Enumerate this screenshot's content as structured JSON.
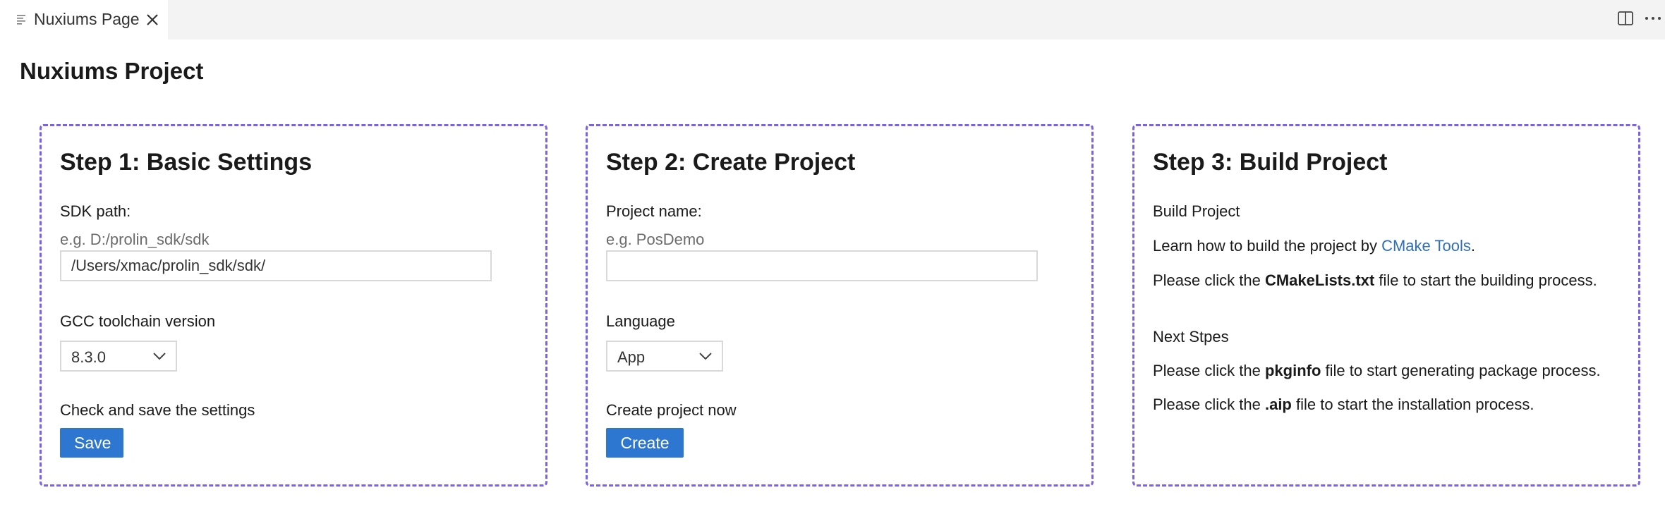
{
  "tab": {
    "title": "Nuxiums Page",
    "icon": "preview-lines-icon",
    "close_icon": "close-icon"
  },
  "toolbar": {
    "split_icon": "split-editor-icon",
    "more_icon": "more-actions-icon"
  },
  "page": {
    "title": "Nuxiums Project"
  },
  "step1": {
    "heading": "Step 1: Basic Settings",
    "sdk_label": "SDK path:",
    "sdk_hint": "e.g. D:/prolin_sdk/sdk",
    "sdk_value": "/Users/xmac/prolin_sdk/sdk/",
    "gcc_label": "GCC toolchain version",
    "gcc_value": "8.3.0",
    "save_label": "Check and save the settings",
    "save_button": "Save"
  },
  "step2": {
    "heading": "Step 2: Create Project",
    "name_label": "Project name:",
    "name_hint": "e.g. PosDemo",
    "name_value": "",
    "language_label": "Language",
    "language_value": "App",
    "create_label": "Create project now",
    "create_button": "Create"
  },
  "step3": {
    "heading": "Step 3: Build Project",
    "build_title": "Build Project",
    "learn_prefix": "Learn how to build the project by ",
    "learn_link": "CMake Tools",
    "learn_suffix": ".",
    "cmake_prefix": "Please click the ",
    "cmake_file": "CMakeLists.txt",
    "cmake_suffix": " file to start the building process.",
    "next_title": "Next Stpes",
    "pkg_prefix": "Please click the ",
    "pkg_file": "pkginfo",
    "pkg_suffix": " file to start generating package process.",
    "aip_prefix": "Please click the ",
    "aip_file": ".aip",
    "aip_suffix": " file to start the installation process."
  },
  "colors": {
    "accent": "#2e77d0",
    "card_border": "#7b61e8",
    "link": "#2f6fb7"
  }
}
